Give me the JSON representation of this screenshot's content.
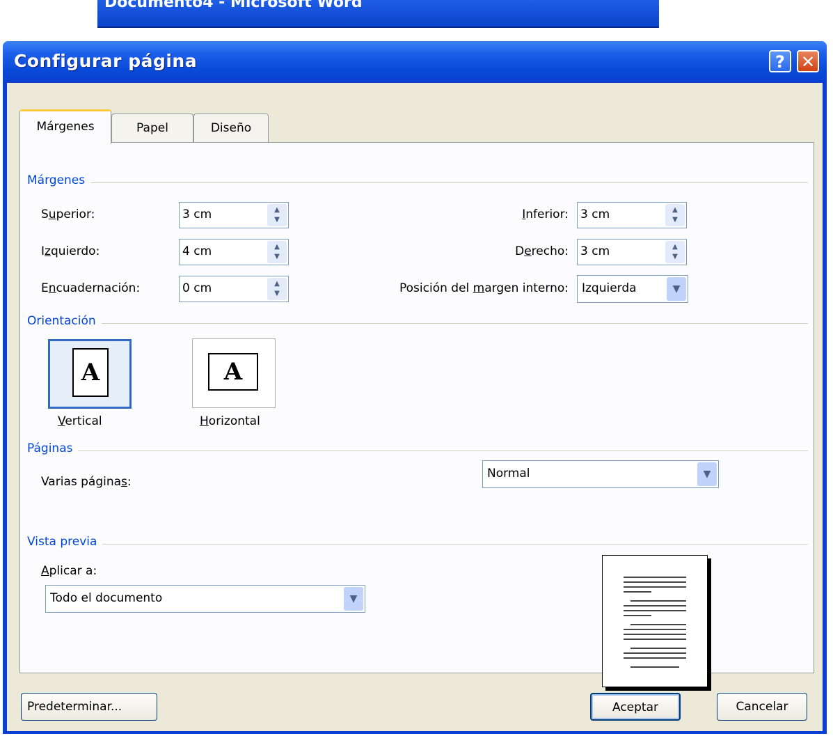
{
  "background_window": {
    "title": "Documento4 - Microsoft Word"
  },
  "dialog": {
    "title": "Configurar página",
    "help_label": "?",
    "close_label": "✕"
  },
  "tabs": [
    {
      "label": "Márgenes",
      "active": true
    },
    {
      "label": "Papel",
      "active": false
    },
    {
      "label": "Diseño",
      "active": false
    }
  ],
  "margins": {
    "group_label": "Márgenes",
    "superior": {
      "label": "Superior:",
      "value": "3 cm"
    },
    "izquierdo": {
      "label": "Izquierdo:",
      "value": "4 cm"
    },
    "encuadernacion": {
      "label": "Encuadernación:",
      "value": "0 cm"
    },
    "inferior": {
      "label": "Inferior:",
      "value": "3 cm"
    },
    "derecho": {
      "label": "Derecho:",
      "value": "3 cm"
    },
    "posicion": {
      "label": "Posición del margen interno:",
      "value": "Izquierda"
    }
  },
  "orientation": {
    "group_label": "Orientación",
    "vertical": {
      "label": "Vertical",
      "selected": true,
      "glyph": "A"
    },
    "horizontal": {
      "label": "Horizontal",
      "selected": false,
      "glyph": "A"
    }
  },
  "pages": {
    "group_label": "Páginas",
    "varias_label": "Varias páginas:",
    "varias_value": "Normal"
  },
  "preview": {
    "group_label": "Vista previa",
    "aplicar_label": "Aplicar a:",
    "aplicar_value": "Todo el documento"
  },
  "buttons": {
    "default": "Predeterminar...",
    "ok": "Aceptar",
    "cancel": "Cancelar"
  },
  "colors": {
    "titlebar": "#0a4ad8",
    "group_label": "#0046d5",
    "dialog_face": "#ece9d8",
    "active_tab_accent": "#ffc83c"
  }
}
